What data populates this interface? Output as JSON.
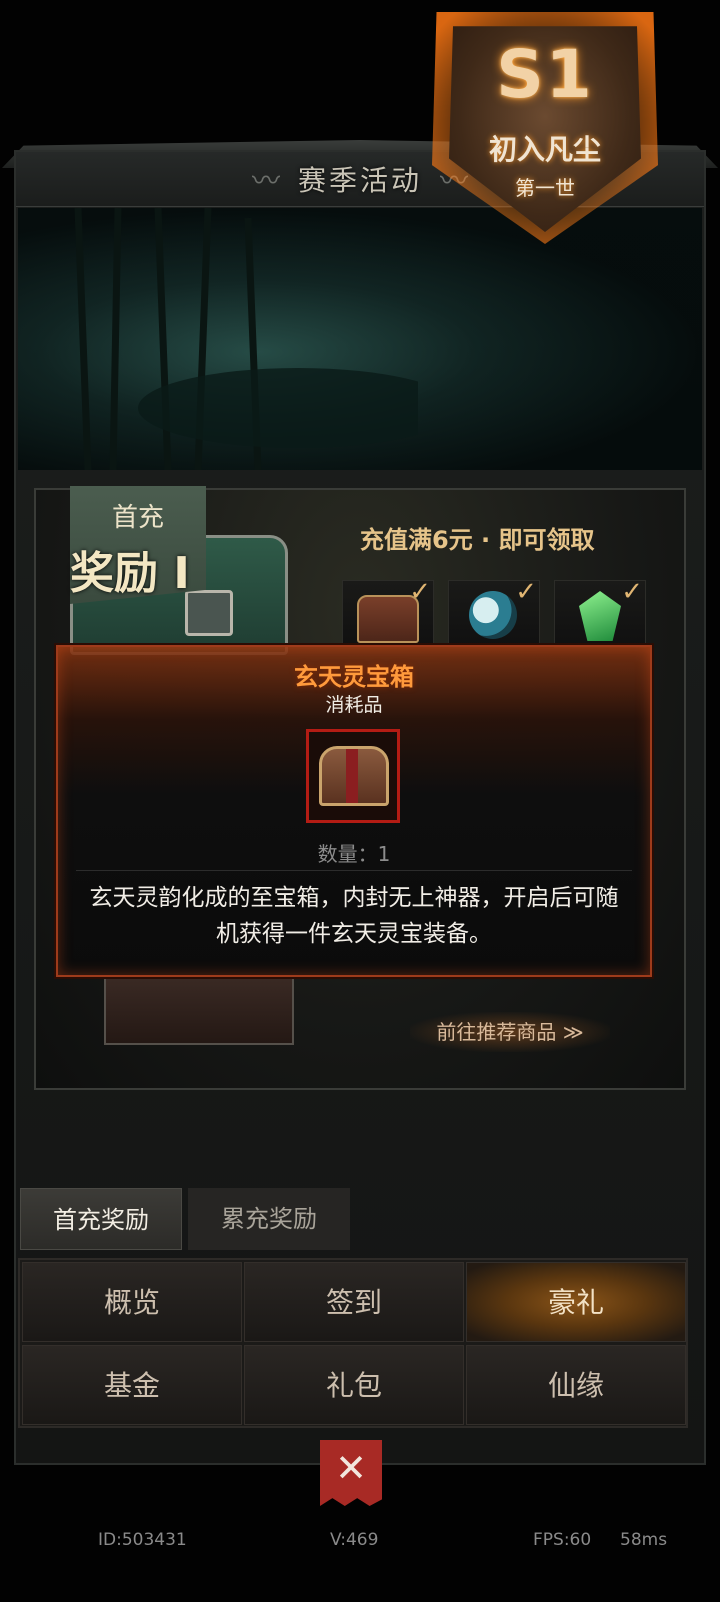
{
  "header": {
    "title": "赛季活动"
  },
  "banner": {
    "season_code": "S1",
    "season_name": "初入凡尘",
    "season_sub": "第一世"
  },
  "reward_card": {
    "tag_small": "首充",
    "tag_big": "奖励 I",
    "condition": "充值满6元 · 即可领取",
    "goto_label": "前往推荐商品 ≫"
  },
  "popup": {
    "title": "玄天灵宝箱",
    "subtitle": "消耗品",
    "quantity": "数量：1",
    "description": "玄天灵韵化成的至宝箱，内封无上神器，开启后可随机获得一件玄天灵宝装备。",
    "title_color": "#ff9a3c",
    "frame_color": "#b41c14"
  },
  "sub_tabs": [
    {
      "label": "首充奖励",
      "active": true
    },
    {
      "label": "累充奖励",
      "active": false
    }
  ],
  "nav": [
    {
      "label": "概览"
    },
    {
      "label": "签到"
    },
    {
      "label": "豪礼",
      "active": true
    },
    {
      "label": "基金"
    },
    {
      "label": "礼包"
    },
    {
      "label": "仙缘"
    }
  ],
  "footer": {
    "id": "ID:503431",
    "version": "V:469",
    "fps": "FPS:60",
    "latency": "58ms"
  },
  "close_icon": "crossed-swords-icon",
  "accent_color": "#e6c48a"
}
